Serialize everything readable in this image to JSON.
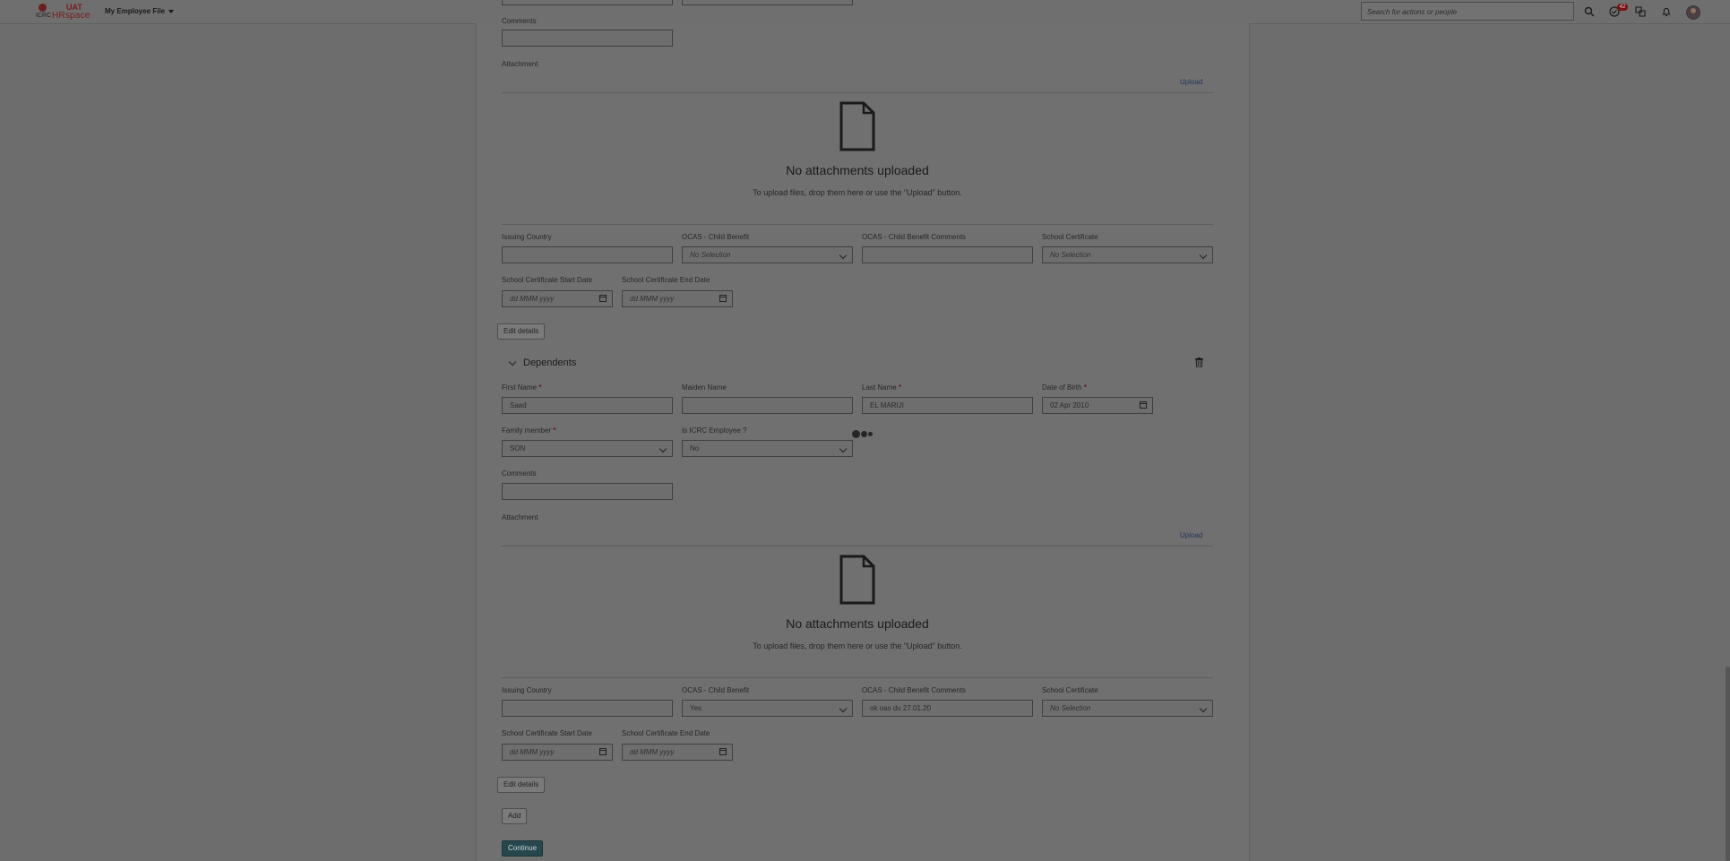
{
  "header": {
    "logo_org": "ICRC",
    "logo_env": "UAT",
    "logo_app": "HRspace",
    "nav_title": "My Employee File",
    "search_placeholder": "Search for actions or people",
    "task_badge": "42"
  },
  "section1": {
    "comments_label": "Comments",
    "comments_value": "",
    "attachment_label": "Attachment",
    "upload_label": "Upload",
    "no_attachments": "No attachments uploaded",
    "upload_hint": "To upload files, drop them here or use the \"Upload\" button.",
    "issuing_country_label": "Issuing Country",
    "issuing_country_value": "",
    "ocas_label": "OCAS - Child Benefit",
    "ocas_value": "No Selection",
    "ocas_comments_label": "OCAS - Child Benefit Comments",
    "ocas_comments_value": "",
    "school_cert_label": "School Certificate",
    "school_cert_value": "No Selection",
    "start_date_label": "School Certificate Start Date",
    "start_date_placeholder": "dd MMM yyyy",
    "end_date_label": "School Certificate End Date",
    "end_date_placeholder": "dd MMM yyyy",
    "edit_details_label": "Edit details"
  },
  "dependents": {
    "title": "Dependents",
    "first_name_label": "First Name",
    "first_name_value": "Saad",
    "maiden_name_label": "Maiden Name",
    "maiden_name_value": "",
    "last_name_label": "Last Name",
    "last_name_value": "EL MARIJI",
    "dob_label": "Date of Birth",
    "dob_value": "02 Apr 2010",
    "family_member_label": "Family member",
    "family_member_value": "SON",
    "is_icrc_label": "Is ICRC Employee ?",
    "is_icrc_value": "No",
    "comments_label": "Comments",
    "comments_value": "",
    "attachment_label": "Attachment",
    "upload_label": "Upload",
    "no_attachments": "No attachments uploaded",
    "upload_hint": "To upload files, drop them here or use the \"Upload\" button.",
    "issuing_country_label": "Issuing Country",
    "issuing_country_value": "",
    "ocas_label": "OCAS - Child Benefit",
    "ocas_value": "Yes",
    "ocas_comments_label": "OCAS - Child Benefit Comments",
    "ocas_comments_value": "ok oas du 27.01.20",
    "school_cert_label": "School Certificate",
    "school_cert_value": "No Selection",
    "start_date_label": "School Certificate Start Date",
    "start_date_placeholder": "dd MMM yyyy",
    "end_date_label": "School Certificate End Date",
    "end_date_placeholder": "dd MMM yyyy",
    "edit_details_label": "Edit details"
  },
  "footer": {
    "add_label": "Add",
    "continue_label": "Continue"
  }
}
